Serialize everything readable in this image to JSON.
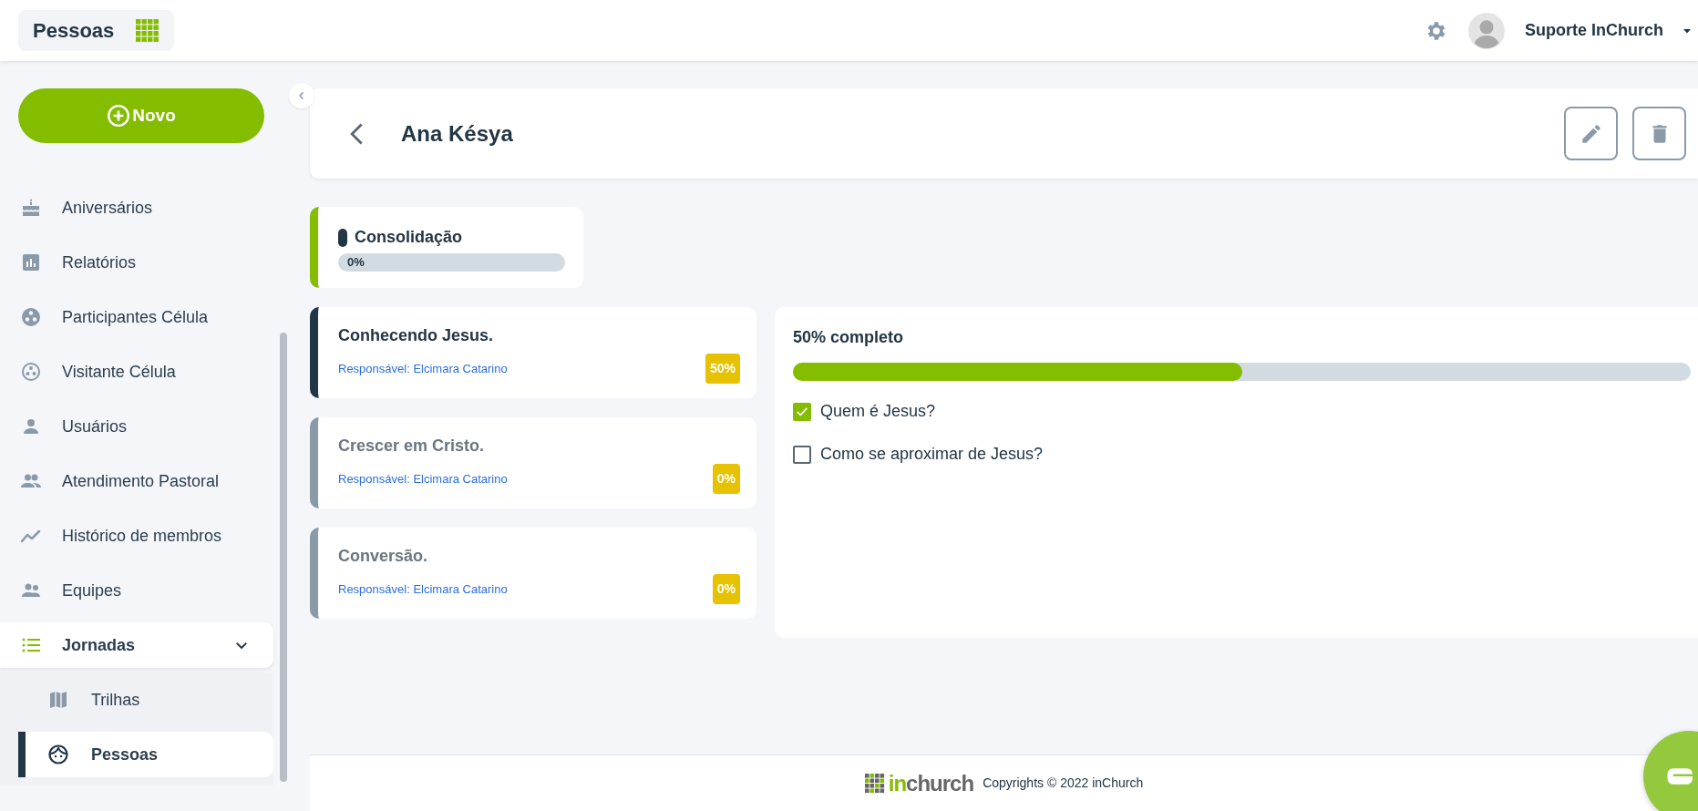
{
  "topbar": {
    "module_title": "Pessoas",
    "user_name": "Suporte InChurch"
  },
  "sidebar": {
    "new_button": "Novo",
    "items": [
      {
        "kind": "link",
        "label": "Aniversários",
        "selected": false
      },
      {
        "kind": "link",
        "label": "Relatórios",
        "selected": false
      },
      {
        "kind": "link",
        "label": "Participantes Célula",
        "selected": false
      },
      {
        "kind": "link",
        "label": "Visitante Célula",
        "selected": false
      },
      {
        "kind": "link",
        "label": "Usuários",
        "selected": false
      },
      {
        "kind": "link",
        "label": "Atendimento Pastoral",
        "selected": false
      },
      {
        "kind": "link",
        "label": "Histórico de membros",
        "selected": false
      },
      {
        "kind": "link",
        "label": "Equipes",
        "selected": false
      },
      {
        "kind": "group",
        "label": "Jornadas",
        "selected": true,
        "expanded": true,
        "children": [
          {
            "label": "Trilhas",
            "selected": false
          },
          {
            "label": "Pessoas",
            "selected": true
          }
        ]
      }
    ]
  },
  "page": {
    "title": "Ana Késya"
  },
  "journey": {
    "title": "Consolidação",
    "progress_label": "0%",
    "level": 0
  },
  "steps": [
    {
      "title": "Conhecendo Jesus.",
      "responsible": "Responsável: Elcimara Catarino",
      "badge": "50%",
      "selected": true
    },
    {
      "title": "Crescer em Cristo.",
      "responsible": "Responsável: Elcimara Catarino",
      "badge": "0%",
      "selected": false
    },
    {
      "title": "Conversão.",
      "responsible": "Responsável: Elcimara Catarino",
      "badge": "0%",
      "selected": false
    }
  ],
  "detail": {
    "progress_label": "50% completo",
    "level": 0.5,
    "tasks": [
      {
        "label": "Quem é Jesus?",
        "checked": true
      },
      {
        "label": "Como se aproximar de Jesus?",
        "checked": false
      }
    ]
  },
  "footer": {
    "logo": [
      "in",
      "church"
    ],
    "text": "Copyrights © 2022 inChurch"
  }
}
